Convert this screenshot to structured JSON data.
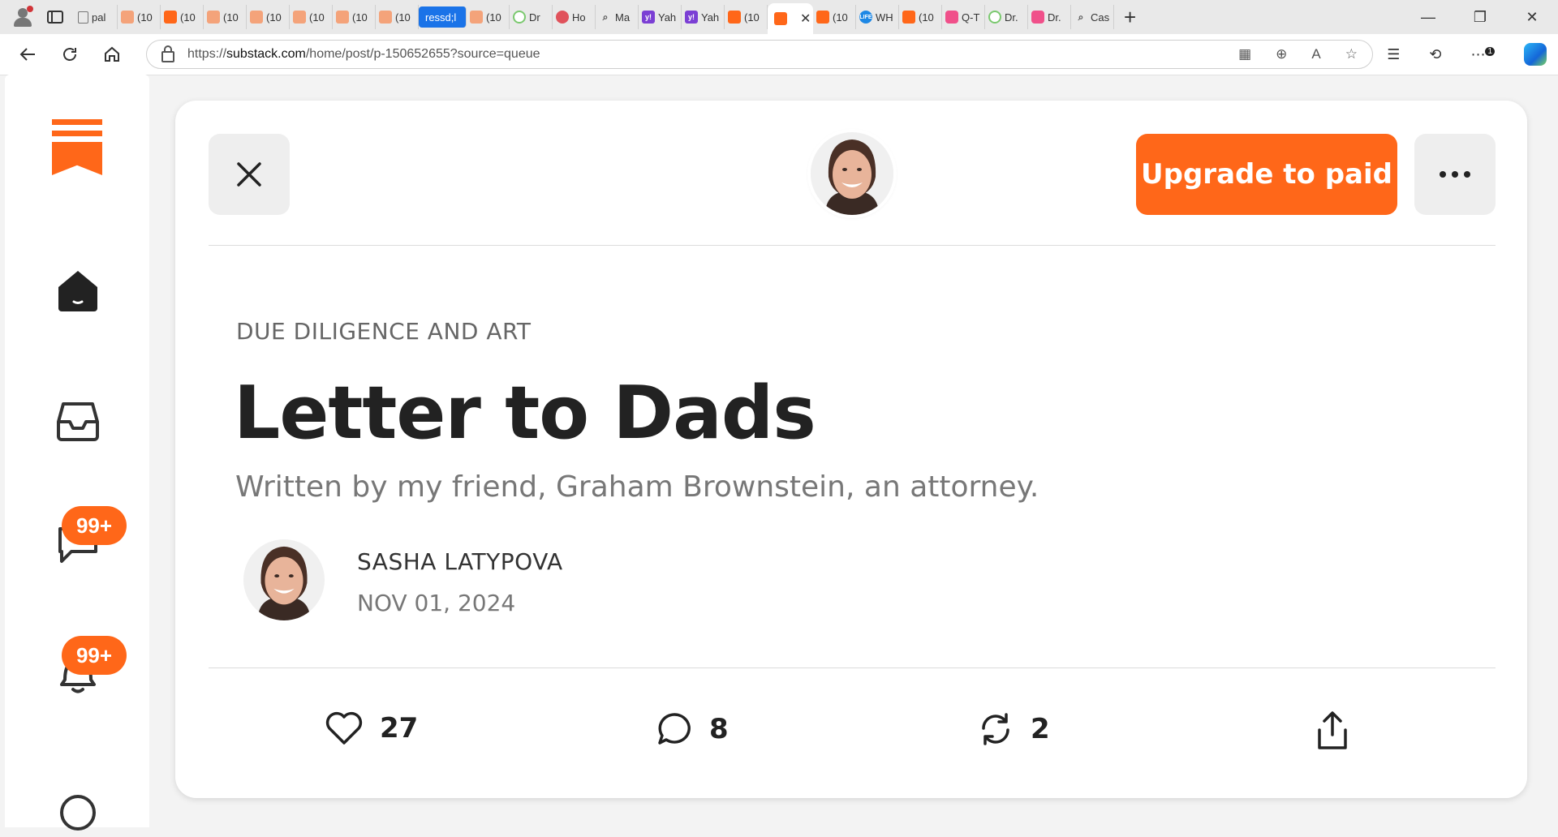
{
  "browser": {
    "tabs": [
      {
        "favicon": "doc",
        "label": "pal"
      },
      {
        "favicon": "substack-light",
        "label": "(10"
      },
      {
        "favicon": "substack",
        "label": "(10"
      },
      {
        "favicon": "substack-light",
        "label": "(10"
      },
      {
        "favicon": "substack-light",
        "label": "(10"
      },
      {
        "favicon": "substack-light",
        "label": "(10"
      },
      {
        "favicon": "substack-light",
        "label": "(10"
      },
      {
        "favicon": "substack-light",
        "label": "(10"
      },
      {
        "favicon": "none",
        "label": "ressd;l"
      },
      {
        "favicon": "substack-light",
        "label": "(10"
      },
      {
        "favicon": "green",
        "label": "Dr"
      },
      {
        "favicon": "red",
        "label": "Ho"
      },
      {
        "favicon": "search",
        "label": "Ma"
      },
      {
        "favicon": "yahoo",
        "label": "Yah"
      },
      {
        "favicon": "yahoo",
        "label": "Yah"
      },
      {
        "favicon": "substack",
        "label": "(10"
      },
      {
        "favicon": "substack",
        "label": ""
      },
      {
        "favicon": "substack",
        "label": "(10"
      },
      {
        "favicon": "life",
        "label": "WH"
      },
      {
        "favicon": "substack",
        "label": "(10"
      },
      {
        "favicon": "yt",
        "label": "Q-T"
      },
      {
        "favicon": "green",
        "label": "Dr."
      },
      {
        "favicon": "yt",
        "label": "Dr."
      },
      {
        "favicon": "search",
        "label": "Cas"
      }
    ],
    "url_prefix": "https://",
    "url_domain": "substack.com",
    "url_path": "/home/post/p-150652655?source=queue",
    "notification_count": "1"
  },
  "sidebar": {
    "chat_badge": "99+",
    "notifications_badge": "99+"
  },
  "post": {
    "upgrade_label": "Upgrade to paid",
    "section": "DUE DILIGENCE AND ART",
    "title": "Letter to Dads",
    "subtitle": "Written by my friend, Graham Brownstein, an attorney.",
    "author": "SASHA LATYPOVA",
    "date": "NOV 01, 2024",
    "likes": "27",
    "comments": "8",
    "restacks": "2"
  },
  "colors": {
    "brand": "#ff6719",
    "text": "#222222",
    "muted": "#777777"
  }
}
